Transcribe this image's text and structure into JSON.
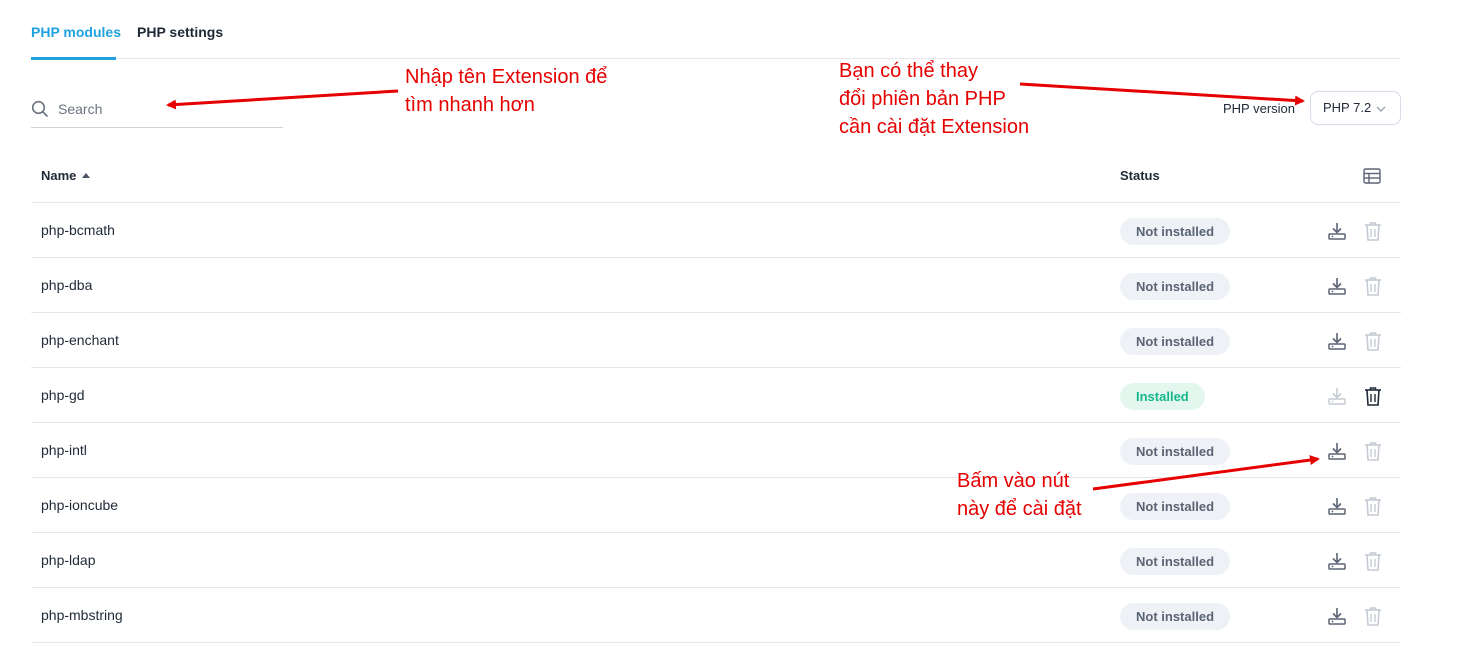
{
  "tabs": [
    {
      "label": "PHP modules",
      "active": true
    },
    {
      "label": "PHP settings",
      "active": false
    }
  ],
  "search": {
    "placeholder": "Search",
    "value": ""
  },
  "php_version": {
    "label": "PHP version",
    "selected": "PHP 7.2"
  },
  "table": {
    "headers": {
      "name": "Name",
      "status": "Status"
    },
    "sort": {
      "column": "Name",
      "direction": "ascending"
    },
    "rows": [
      {
        "name": "php-bcmath",
        "status": "Not installed",
        "installed": false
      },
      {
        "name": "php-dba",
        "status": "Not installed",
        "installed": false
      },
      {
        "name": "php-enchant",
        "status": "Not installed",
        "installed": false
      },
      {
        "name": "php-gd",
        "status": "Installed",
        "installed": true
      },
      {
        "name": "php-intl",
        "status": "Not installed",
        "installed": false
      },
      {
        "name": "php-ioncube",
        "status": "Not installed",
        "installed": false
      },
      {
        "name": "php-ldap",
        "status": "Not installed",
        "installed": false
      },
      {
        "name": "php-mbstring",
        "status": "Not installed",
        "installed": false
      }
    ]
  },
  "annotations": {
    "search_hint": [
      "Nhập tên Extension để",
      "tìm nhanh hơn"
    ],
    "version_hint": [
      "Bạn có thể thay",
      "đổi phiên bản PHP",
      "cần cài đặt Extension"
    ],
    "install_hint": [
      "Bấm vào nút",
      "này để cài đặt"
    ]
  },
  "colors": {
    "accent": "#1fa3e0",
    "installed_badge_bg": "#e3f7ef",
    "installed_badge_text": "#16b88a",
    "not_installed_badge_bg": "#eef1f6",
    "not_installed_badge_text": "#5b6474",
    "annotation_red": "#e60000"
  },
  "icons": {
    "search": "search-icon",
    "columns": "table-columns-icon",
    "install": "download-install-icon",
    "delete": "trash-icon",
    "sort": "sort-ascending-icon",
    "select": "chevron-down-icon"
  }
}
